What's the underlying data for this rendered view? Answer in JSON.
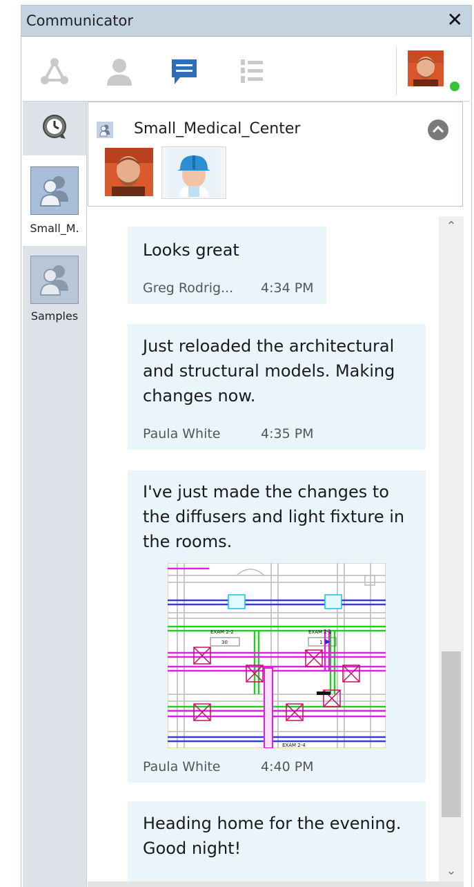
{
  "window": {
    "title": "Communicator",
    "close_glyph": "✕"
  },
  "toolbar": {
    "items": [
      {
        "name": "network-icon",
        "active": false
      },
      {
        "name": "contact-icon",
        "active": false
      },
      {
        "name": "chat-icon",
        "active": true
      },
      {
        "name": "task-list-icon",
        "active": false
      }
    ],
    "presence_color": "#35c435"
  },
  "sidebar": {
    "history_icon": "history-icon",
    "conversations": [
      {
        "label": "Small_M.",
        "active": true
      },
      {
        "label": "Samples",
        "active": false
      }
    ]
  },
  "conversation": {
    "name": "Small_Medical_Center",
    "participants": [
      "greg-avatar",
      "engineer-avatar"
    ]
  },
  "messages": [
    {
      "text": "Looks great",
      "author": "Greg Rodrig...",
      "time": "4:34 PM"
    },
    {
      "text": "Just reloaded the architectural and structural models.  Making changes now.",
      "author": "Paula White",
      "time": "4:35 PM"
    },
    {
      "text": "I've just made the changes to the diffusers and light fixture in the rooms.",
      "author": "Paula White",
      "time": "4:40 PM",
      "attachment": {
        "labels": [
          "EXAM 2-2",
          "EXAM 2-1",
          "30",
          "1",
          "EXAM 2-4"
        ]
      }
    },
    {
      "text": "Heading home for the evening. Good night!"
    }
  ],
  "colors": {
    "accent": "#2f6eb6",
    "bubble": "#e9f4fb",
    "titlebar": "#c5d3e1"
  }
}
